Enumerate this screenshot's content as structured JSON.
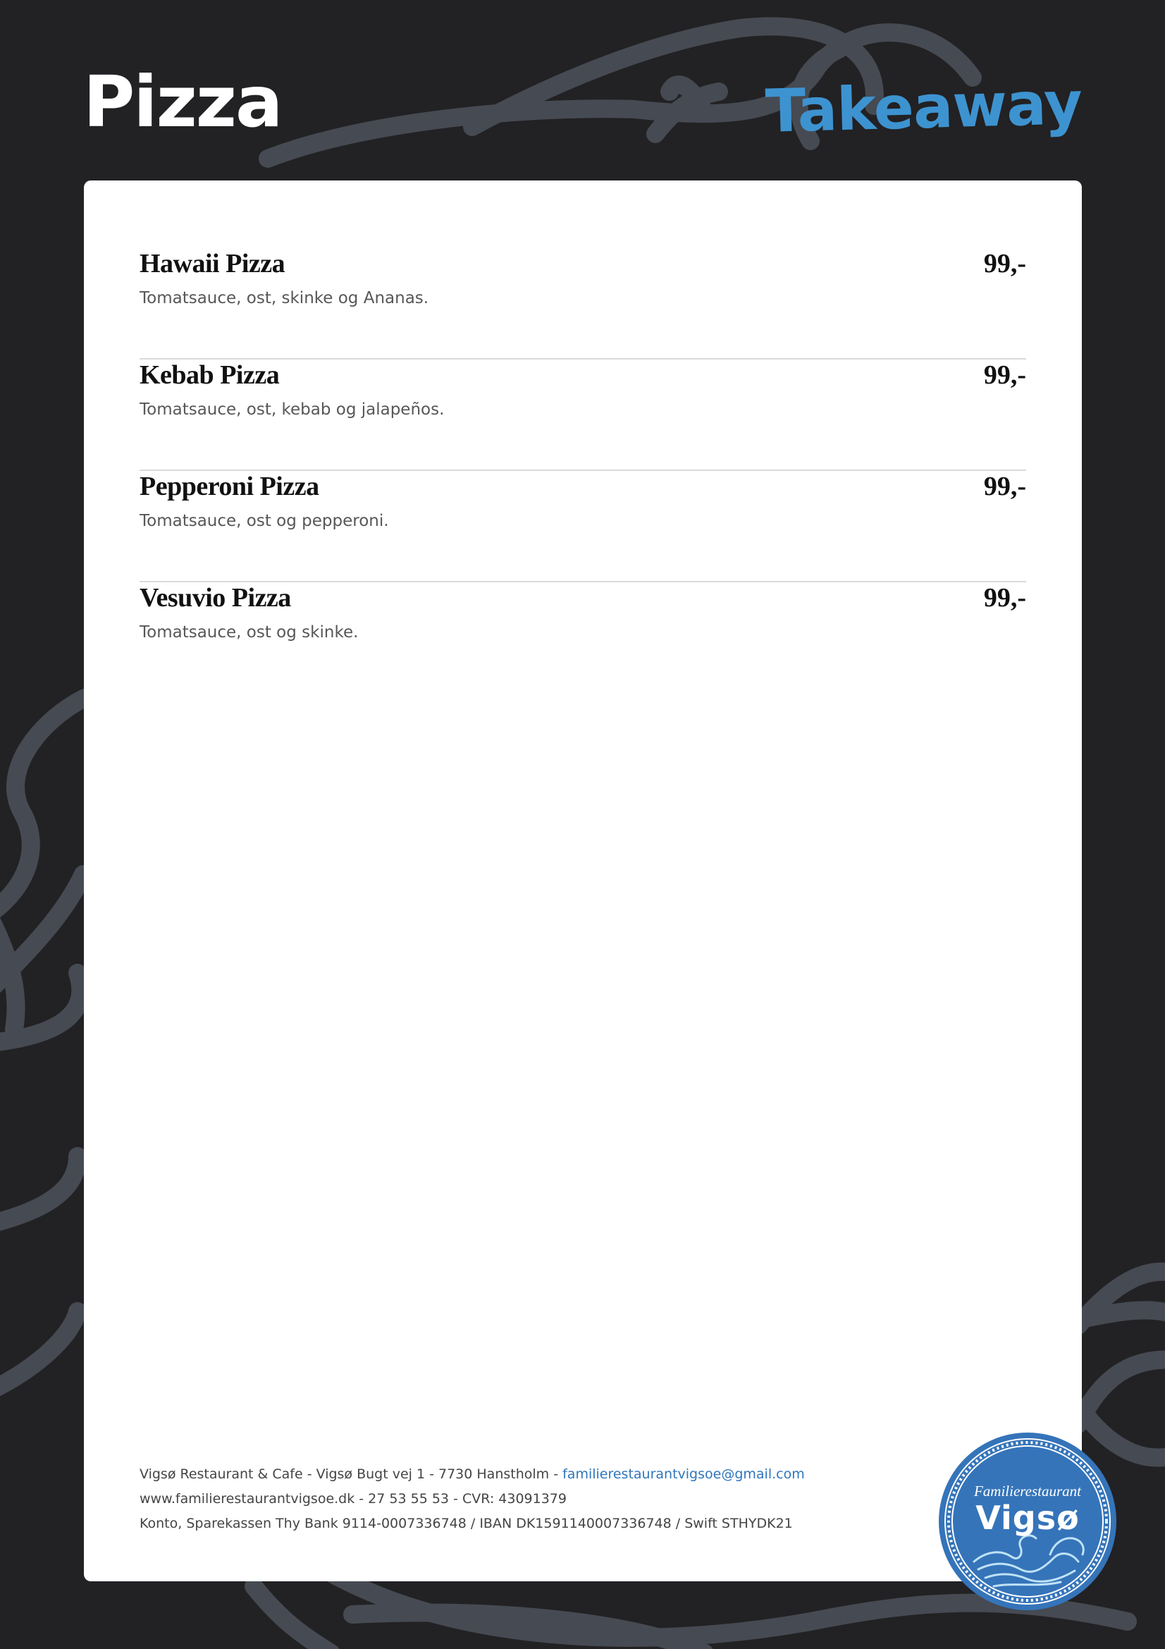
{
  "header": {
    "title": "Pizza",
    "takeaway": "Takeaway"
  },
  "menu": {
    "items": [
      {
        "name": "Hawaii Pizza",
        "price": "99,-",
        "description": "Tomatsauce, ost, skinke og Ananas."
      },
      {
        "name": "Kebab Pizza",
        "price": "99,-",
        "description": "Tomatsauce, ost, kebab og jalapeños."
      },
      {
        "name": "Pepperoni Pizza",
        "price": "99,-",
        "description": "Tomatsauce, ost og pepperoni."
      },
      {
        "name": "Vesuvio Pizza",
        "price": "99,-",
        "description": "Tomatsauce, ost og skinke."
      }
    ]
  },
  "footer": {
    "line1_text": "Vigsø Restaurant & Cafe - Vigsø Bugt vej 1 - 7730 Hanstholm - ",
    "email": "familierestaurantvigsoe@gmail.com",
    "line2": "www.familierestaurantvigsoe.dk - 27 53 55 53 - CVR: 43091379",
    "line3": "Konto, Sparekassen Thy Bank 9114-0007336748 / IBAN DK1591140007336748 / Swift STHYDK21"
  },
  "logo": {
    "top_text": "Familierestaurant",
    "main_text": "Vigsø"
  },
  "colors": {
    "background": "#222124",
    "accent": "#3d93d0",
    "link": "#2f76bc",
    "badge": "#3574b9",
    "outline_art": "#464a52"
  }
}
